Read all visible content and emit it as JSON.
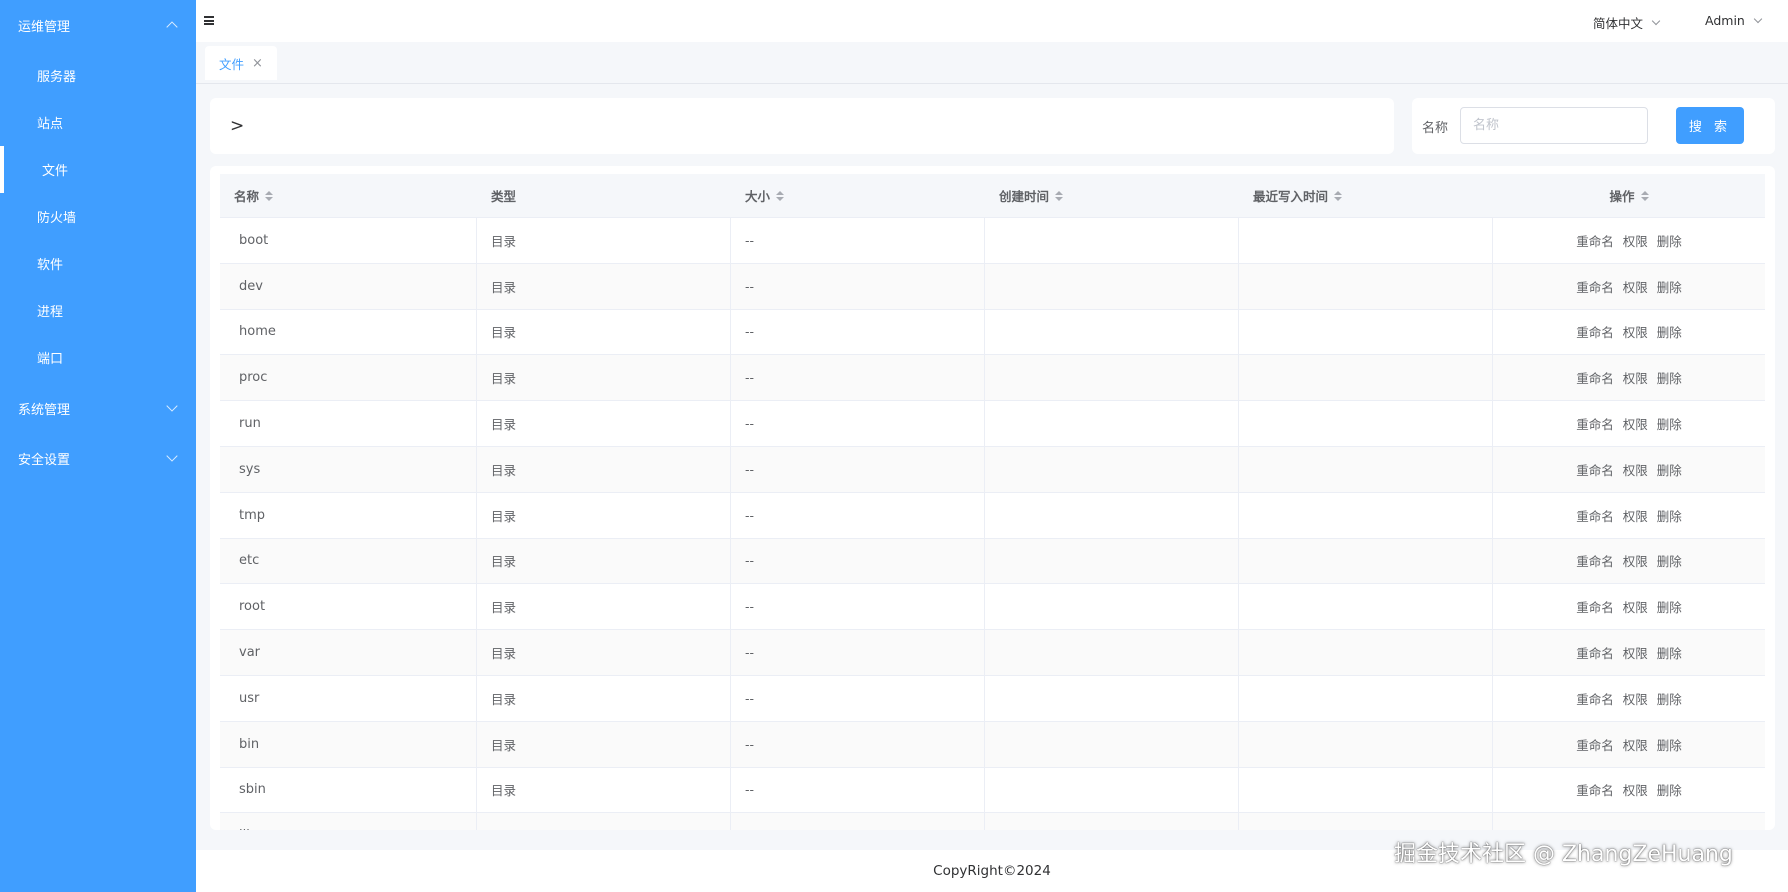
{
  "sidebar": {
    "group_ops": "运维管理",
    "items": [
      {
        "label": "服务器"
      },
      {
        "label": "站点"
      },
      {
        "label": "文件"
      },
      {
        "label": "防火墙"
      },
      {
        "label": "软件"
      },
      {
        "label": "进程"
      },
      {
        "label": "端口"
      }
    ],
    "group_system": "系统管理",
    "group_security": "安全设置"
  },
  "header": {
    "language": "简体中文",
    "user": "Admin"
  },
  "tabs": [
    {
      "label": "文件",
      "close": "×"
    }
  ],
  "path": {
    "text": ">"
  },
  "search": {
    "label": "名称",
    "placeholder": "名称",
    "button": "搜 索"
  },
  "table": {
    "columns": [
      "名称",
      "类型",
      "大小",
      "创建时间",
      "最近写入时间",
      "操作"
    ],
    "rows": [
      {
        "name": "boot",
        "type": "目录",
        "size": "--"
      },
      {
        "name": "dev",
        "type": "目录",
        "size": "--"
      },
      {
        "name": "home",
        "type": "目录",
        "size": "--"
      },
      {
        "name": "proc",
        "type": "目录",
        "size": "--"
      },
      {
        "name": "run",
        "type": "目录",
        "size": "--"
      },
      {
        "name": "sys",
        "type": "目录",
        "size": "--"
      },
      {
        "name": "tmp",
        "type": "目录",
        "size": "--"
      },
      {
        "name": "etc",
        "type": "目录",
        "size": "--"
      },
      {
        "name": "root",
        "type": "目录",
        "size": "--"
      },
      {
        "name": "var",
        "type": "目录",
        "size": "--"
      },
      {
        "name": "usr",
        "type": "目录",
        "size": "--"
      },
      {
        "name": "bin",
        "type": "目录",
        "size": "--"
      },
      {
        "name": "sbin",
        "type": "目录",
        "size": "--"
      },
      {
        "name": "lib",
        "type": "目录",
        "size": "--"
      }
    ],
    "actions": {
      "rename": "重命名",
      "permission": "权限",
      "delete": "删除"
    }
  },
  "footer": {
    "copyright": "CopyRight©2024"
  },
  "watermark": "掘金技术社区 @ ZhangZeHuang",
  "colors": {
    "primary": "#409eff",
    "background": "#f5f7fa"
  }
}
